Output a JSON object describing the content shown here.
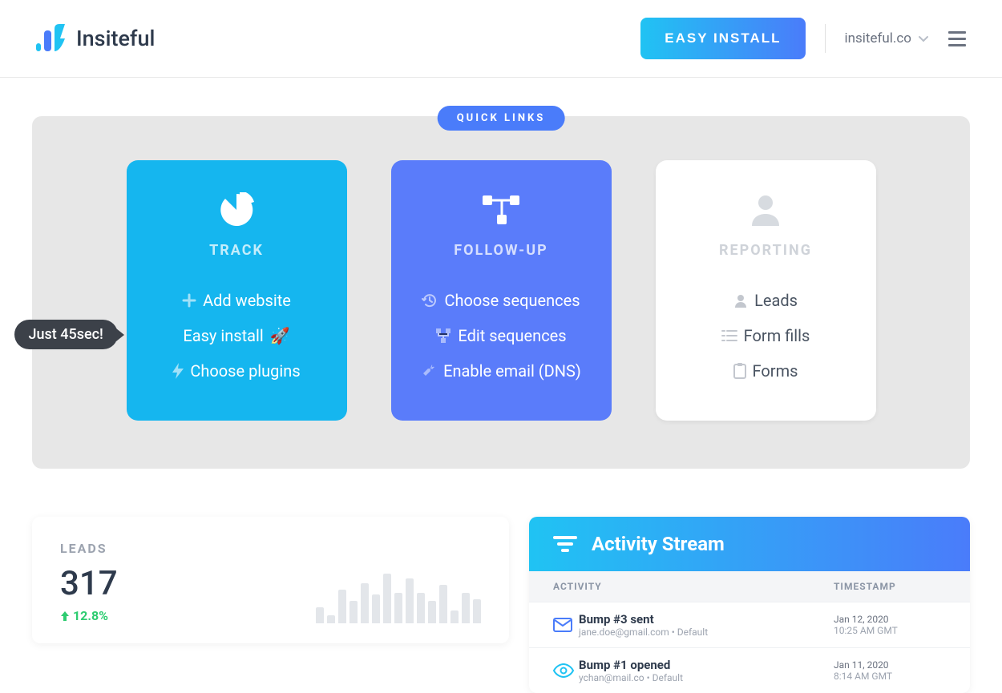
{
  "header": {
    "brand": "Insiteful",
    "easy_install_label": "EASY INSTALL",
    "domain": "insiteful.co"
  },
  "quick_links": {
    "badge": "QUICK LINKS",
    "track": {
      "title": "TRACK",
      "links": {
        "add_website": "Add website",
        "easy_install": "Easy install",
        "choose_plugins": "Choose plugins"
      },
      "tooltip": "Just 45sec!",
      "rocket": "🚀"
    },
    "follow": {
      "title": "FOLLOW-UP",
      "links": {
        "choose_sequences": "Choose sequences",
        "edit_sequences": "Edit sequences",
        "enable_email": "Enable email (DNS)"
      }
    },
    "report": {
      "title": "REPORTING",
      "links": {
        "leads": "Leads",
        "form_fills": "Form fills",
        "forms": "Forms"
      }
    }
  },
  "leads": {
    "label": "LEADS",
    "value": "317",
    "change": "12.8%"
  },
  "activity": {
    "title": "Activity Stream",
    "col_activity": "ACTIVITY",
    "col_timestamp": "TIMESTAMP",
    "rows": [
      {
        "title": "Bump #3 sent",
        "sub": "jane.doe@gmail.com • Default",
        "date": "Jan 12, 2020",
        "time": "10:25 AM GMT"
      },
      {
        "title": "Bump #1 opened",
        "sub": "ychan@mail.co • Default",
        "date": "Jan 11, 2020",
        "time": "8:14 AM GMT"
      }
    ]
  },
  "chart_data": {
    "type": "bar",
    "title": "Leads sparkline",
    "values": [
      20,
      10,
      42,
      28,
      50,
      36,
      62,
      38,
      56,
      38,
      28,
      48,
      16,
      38,
      30
    ]
  }
}
